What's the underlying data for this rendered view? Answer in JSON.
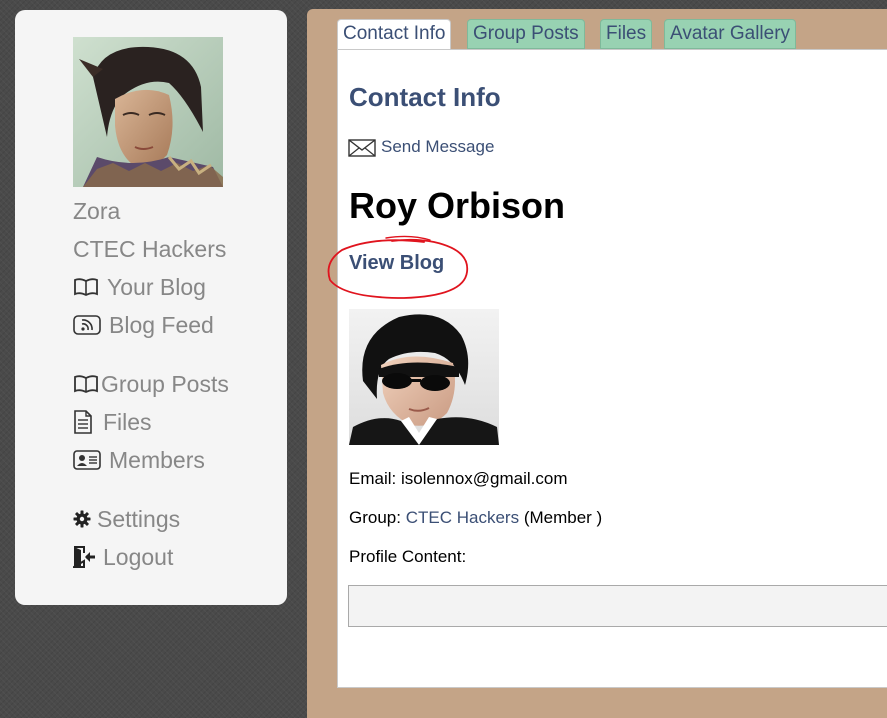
{
  "sidebar": {
    "username": "Zora",
    "group_name": "CTEC Hackers",
    "items": [
      {
        "label": "Your Blog",
        "icon": "book-icon"
      },
      {
        "label": "Blog Feed",
        "icon": "rss-icon"
      },
      {
        "label": "Group Posts",
        "icon": "book-icon"
      },
      {
        "label": "Files",
        "icon": "file-icon"
      },
      {
        "label": "Members",
        "icon": "id-card-icon"
      },
      {
        "label": "Settings",
        "icon": "gear-icon"
      },
      {
        "label": "Logout",
        "icon": "logout-icon"
      }
    ]
  },
  "tabs": [
    {
      "label": "Contact Info",
      "active": true
    },
    {
      "label": "Group Posts",
      "active": false
    },
    {
      "label": "Files",
      "active": false
    },
    {
      "label": "Avatar Gallery",
      "active": false
    }
  ],
  "contact": {
    "section_title": "Contact Info",
    "send_message_label": "Send Message",
    "profile_name": "Roy Orbison",
    "view_blog_label": "View Blog",
    "email_label": "Email:",
    "email_value": "isolennox@gmail.com",
    "group_label": "Group:",
    "group_link": "CTEC Hackers",
    "group_role": "(Member )",
    "profile_content_label": "Profile Content:"
  },
  "colors": {
    "link": "#3b4f75",
    "tab_inactive": "#98d2b2",
    "frame": "#c4a487",
    "sidebar": "#f5f5f5",
    "annotation": "#e0141e"
  }
}
